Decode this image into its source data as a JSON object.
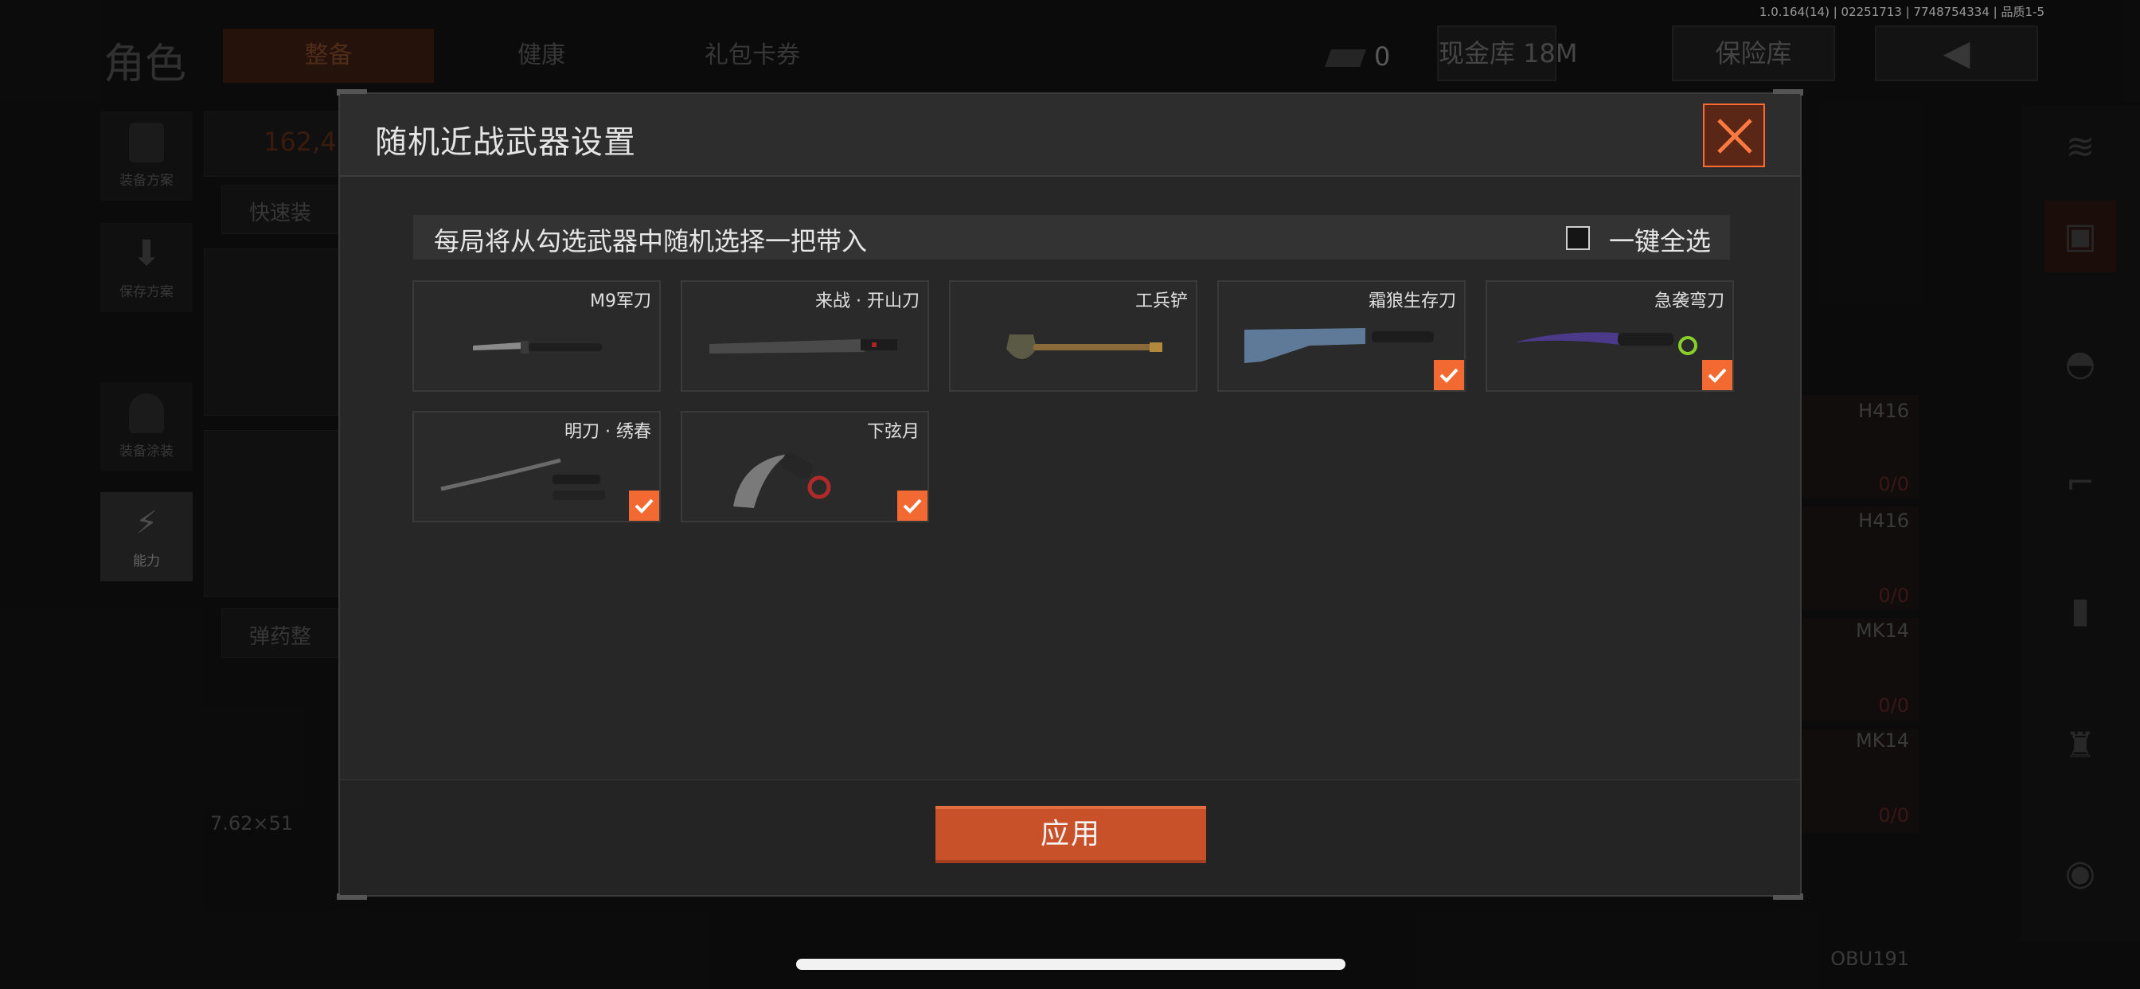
{
  "build_info": "1.0.164(14) | 02251713 | 7748754334 | 品质1-5",
  "background": {
    "title": "角色",
    "tabs": [
      "整备",
      "健康",
      "礼包卡券"
    ],
    "currency_value": "0",
    "vault_label": "现金库 18M",
    "safe_label": "保险库",
    "left_tools": [
      "装备方案",
      "保存方案",
      "装备涂装",
      "能力"
    ],
    "score": "162,4",
    "quick_label": "快速装",
    "ammo_label": "弹药整",
    "caliber": "7.62×51",
    "right_slots": [
      {
        "name": "H416",
        "count": "0/0"
      },
      {
        "name": "H416",
        "count": "0/0"
      },
      {
        "name": "MK14",
        "count": "0/0"
      },
      {
        "name": "MK14",
        "count": "0/0"
      }
    ],
    "bottom_label": "OBU191"
  },
  "modal": {
    "title": "随机近战武器设置",
    "instruction": "每局将从勾选武器中随机选择一把带入",
    "select_all_label": "一键全选",
    "select_all_checked": false,
    "apply_label": "应用",
    "weapons": [
      {
        "name": "M9军刀",
        "checked": false,
        "icon": "bayonet-icon"
      },
      {
        "name": "来战 · 开山刀",
        "checked": false,
        "icon": "machete-icon"
      },
      {
        "name": "工兵铲",
        "checked": false,
        "icon": "shovel-icon"
      },
      {
        "name": "霜狼生存刀",
        "checked": true,
        "icon": "survival-knife-icon"
      },
      {
        "name": "急袭弯刀",
        "checked": true,
        "icon": "curved-knife-icon"
      },
      {
        "name": "明刀 · 绣春",
        "checked": true,
        "icon": "katana-icon"
      },
      {
        "name": "下弦月",
        "checked": true,
        "icon": "karambit-icon"
      }
    ]
  },
  "colors": {
    "accent": "#f26a31",
    "apply": "#c9512a"
  }
}
